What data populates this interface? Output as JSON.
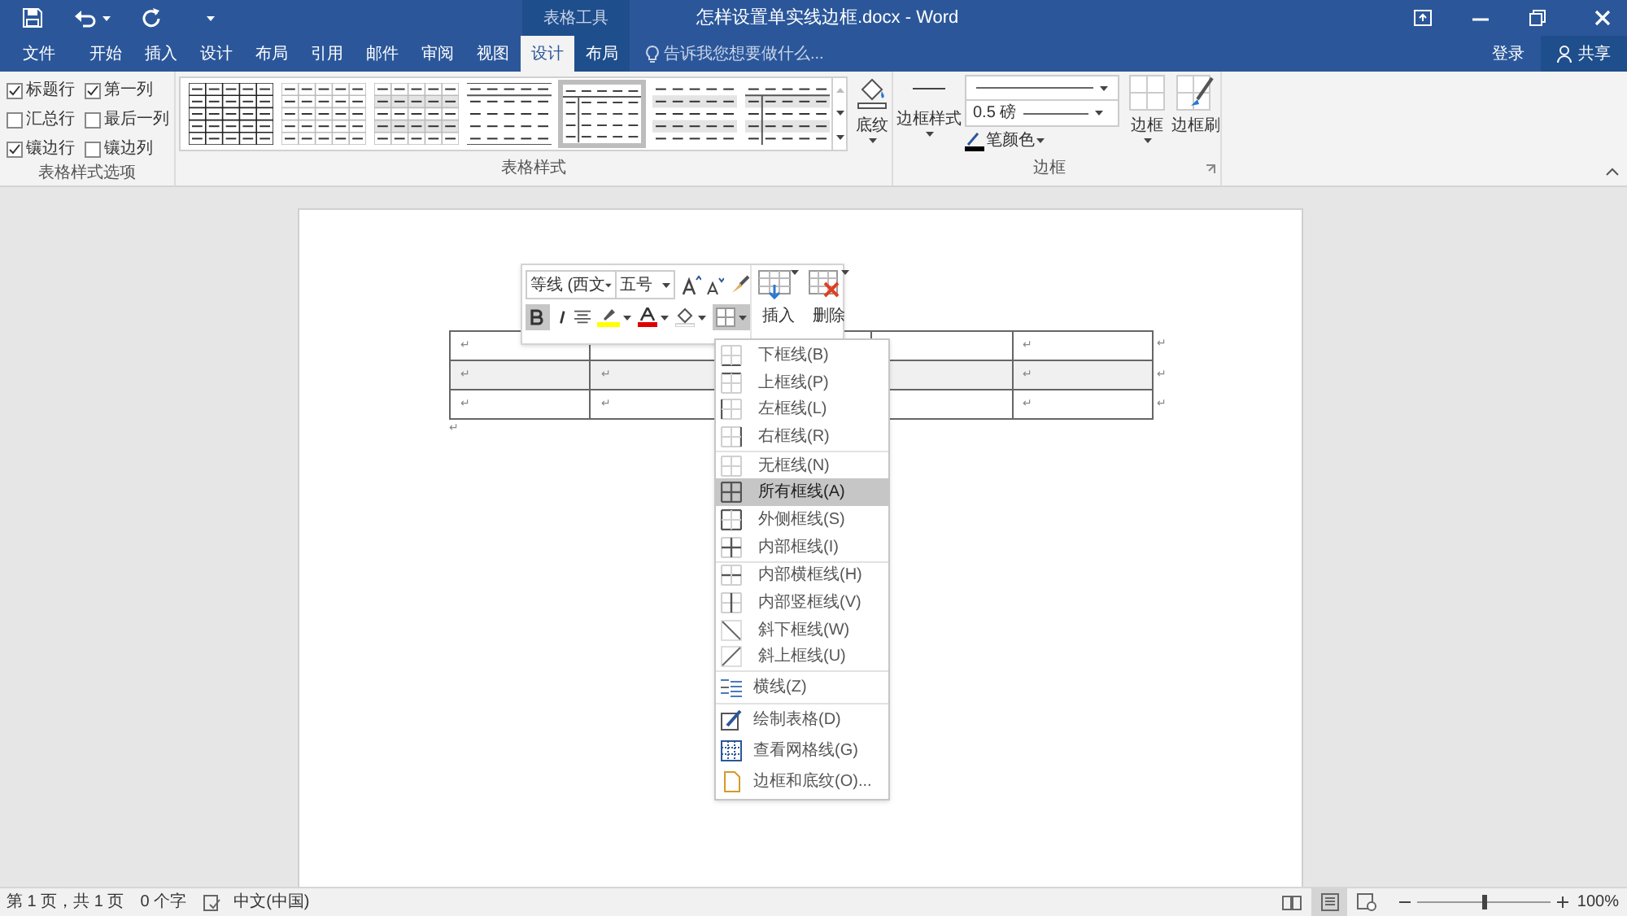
{
  "title_bar": {
    "contextual_group": "表格工具",
    "title": "怎样设置单实线边框.docx - Word"
  },
  "menu_tabs": [
    {
      "label": "文件",
      "selected": false,
      "kind": "normal"
    },
    {
      "label": "开始",
      "selected": false,
      "kind": "normal"
    },
    {
      "label": "插入",
      "selected": false,
      "kind": "normal"
    },
    {
      "label": "设计",
      "selected": false,
      "kind": "normal"
    },
    {
      "label": "布局",
      "selected": false,
      "kind": "normal"
    },
    {
      "label": "引用",
      "selected": false,
      "kind": "normal"
    },
    {
      "label": "邮件",
      "selected": false,
      "kind": "normal"
    },
    {
      "label": "审阅",
      "selected": false,
      "kind": "normal"
    },
    {
      "label": "视图",
      "selected": false,
      "kind": "normal"
    },
    {
      "label": "设计",
      "selected": true,
      "kind": "contextual"
    },
    {
      "label": "布局",
      "selected": false,
      "kind": "contextual"
    }
  ],
  "tell_me": {
    "placeholder": "告诉我您想要做什么..."
  },
  "account": {
    "sign_in": "登录",
    "share": "共享"
  },
  "ribbon": {
    "style_options": {
      "label": "表格样式选项",
      "checkboxes": [
        {
          "label": "标题行",
          "checked": true
        },
        {
          "label": "第一列",
          "checked": true
        },
        {
          "label": "汇总行",
          "checked": false
        },
        {
          "label": "最后一列",
          "checked": false
        },
        {
          "label": "镶边行",
          "checked": true
        },
        {
          "label": "镶边列",
          "checked": false
        }
      ]
    },
    "table_styles": {
      "label": "表格样式",
      "gallery": [
        {
          "kind": "grid",
          "selected": false
        },
        {
          "kind": "light_grid",
          "selected": false
        },
        {
          "kind": "banded_grid",
          "selected": false
        },
        {
          "kind": "rules",
          "selected": false
        },
        {
          "kind": "first_column",
          "selected": true
        },
        {
          "kind": "banded",
          "selected": false
        },
        {
          "kind": "banded_column",
          "selected": false
        }
      ]
    },
    "shading": "底纹",
    "borders": {
      "label": "边框",
      "border_styles": "边框样式",
      "line_weight": "0.5 磅",
      "pen_color": "笔颜色",
      "borders_button": "边框",
      "border_painter": "边框刷"
    }
  },
  "mini_toolbar": {
    "font": "等线 (西文",
    "size": "五号",
    "bold_on": true,
    "borders_open": true,
    "insert": "插入",
    "delete": "删除"
  },
  "border_menu": {
    "sections": [
      [
        {
          "label": "下框线(B)",
          "kind": "bottom",
          "selected": false
        },
        {
          "label": "上框线(P)",
          "kind": "top",
          "selected": false
        },
        {
          "label": "左框线(L)",
          "kind": "left",
          "selected": false
        },
        {
          "label": "右框线(R)",
          "kind": "right",
          "selected": false
        }
      ],
      [
        {
          "label": "无框线(N)",
          "kind": "none",
          "selected": false
        },
        {
          "label": "所有框线(A)",
          "kind": "all",
          "selected": true
        },
        {
          "label": "外侧框线(S)",
          "kind": "outside",
          "selected": false
        },
        {
          "label": "内部框线(I)",
          "kind": "inside",
          "selected": false
        }
      ],
      [
        {
          "label": "内部横框线(H)",
          "kind": "inside_h",
          "selected": false
        },
        {
          "label": "内部竖框线(V)",
          "kind": "inside_v",
          "selected": false
        },
        {
          "label": "斜下框线(W)",
          "kind": "diag_down",
          "selected": false
        },
        {
          "label": "斜上框线(U)",
          "kind": "diag_up",
          "selected": false
        }
      ],
      [
        {
          "label": "横线(Z)",
          "kind": "hline",
          "selected": false
        }
      ],
      [
        {
          "label": "绘制表格(D)",
          "kind": "draw",
          "selected": false
        },
        {
          "label": "查看网格线(G)",
          "kind": "gridlines",
          "selected": false
        },
        {
          "label": "边框和底纹(O)...",
          "kind": "dialog",
          "selected": false
        }
      ]
    ]
  },
  "document": {
    "table": {
      "rows": [
        {
          "shaded": false,
          "cells": [
            {
              "text": "↵"
            },
            {},
            {},
            {},
            {
              "text": "↵"
            }
          ],
          "end_mark": "↵"
        },
        {
          "shaded": true,
          "cells": [
            {
              "text": "↵"
            },
            {
              "text": "↵"
            },
            {},
            {},
            {
              "text": "↵"
            }
          ],
          "end_mark": "↵"
        },
        {
          "shaded": false,
          "cells": [
            {
              "text": "↵"
            },
            {
              "text": "↵"
            },
            {},
            {},
            {
              "text": "↵"
            }
          ],
          "end_mark": "↵"
        }
      ]
    },
    "after_mark": "↵"
  },
  "status_bar": {
    "page": "第 1 页，共 1 页",
    "words": "0 个字",
    "language": "中文(中国)",
    "views": [
      {
        "kind": "read",
        "selected": false
      },
      {
        "kind": "print",
        "selected": true
      },
      {
        "kind": "web",
        "selected": false
      }
    ],
    "zoom": {
      "level": 0.5,
      "reading": "100%"
    }
  }
}
